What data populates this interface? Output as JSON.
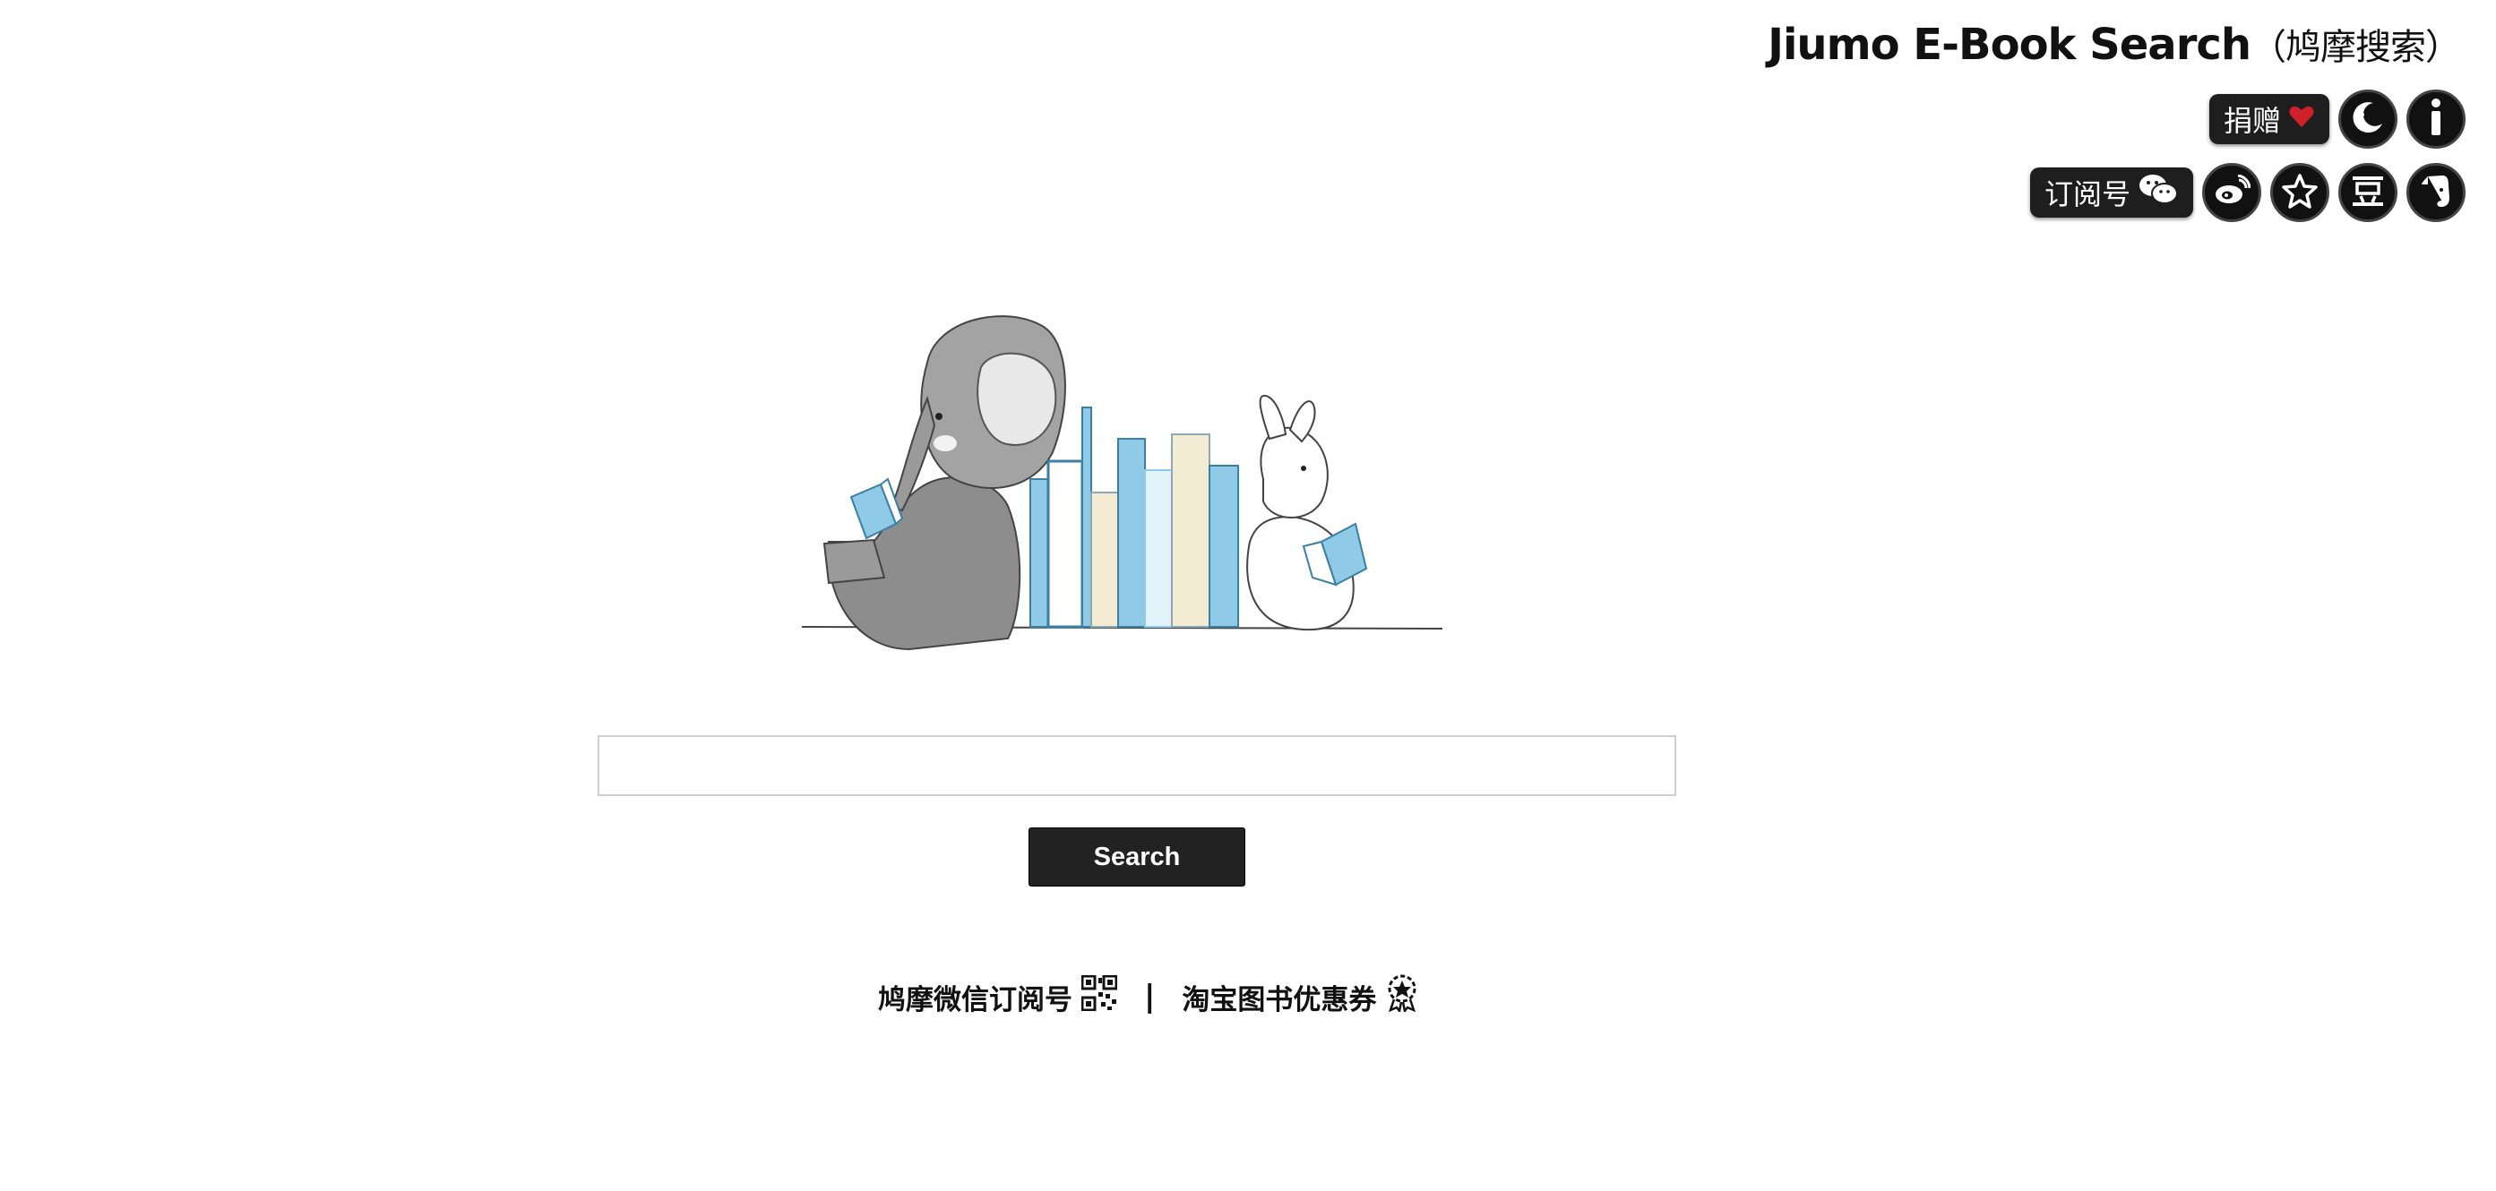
{
  "header": {
    "title": "Jiumo E-Book Search",
    "title_cn": "（鸠摩搜索）",
    "donate_label": "捐赠",
    "subscribe_label": "订阅号"
  },
  "icons": {
    "donate": "heart-icon",
    "night_mode": "moon-icon",
    "info": "info-icon",
    "wechat": "wechat-icon",
    "weibo": "weibo-icon",
    "favorite": "star-icon",
    "douban": "douban-icon",
    "evernote": "evernote-icon"
  },
  "search": {
    "value": "",
    "placeholder": "",
    "button_label": "Search"
  },
  "footer": {
    "wechat_link": "鸠摩微信订阅号",
    "separator": "|",
    "coupon_link": "淘宝图书优惠券"
  },
  "colors": {
    "button_bg": "#222222",
    "heart": "#d0202a",
    "book_blue": "#8fcbe6",
    "book_cream": "#f3ecd3"
  }
}
